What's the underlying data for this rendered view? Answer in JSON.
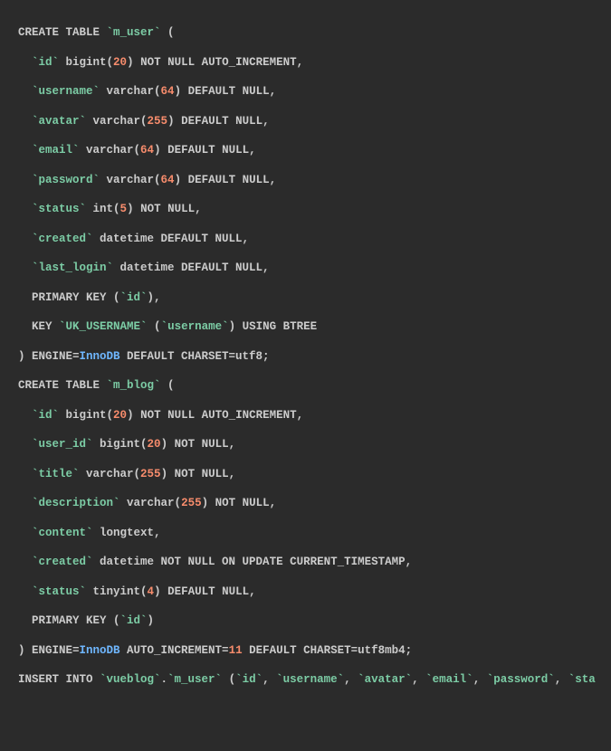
{
  "tokens": [
    [
      {
        "t": "CREATE TABLE ",
        "c": "plain"
      },
      {
        "t": "`m_user`",
        "c": "bt"
      },
      {
        "t": " (",
        "c": "plain"
      }
    ],
    [
      {
        "t": "  ",
        "c": "plain"
      },
      {
        "t": "`id`",
        "c": "bt"
      },
      {
        "t": " bigint(",
        "c": "plain"
      },
      {
        "t": "20",
        "c": "kw-num"
      },
      {
        "t": ") NOT NULL AUTO_INCREMENT,",
        "c": "plain"
      }
    ],
    [
      {
        "t": "  ",
        "c": "plain"
      },
      {
        "t": "`username`",
        "c": "bt"
      },
      {
        "t": " varchar(",
        "c": "plain"
      },
      {
        "t": "64",
        "c": "kw-num"
      },
      {
        "t": ") DEFAULT NULL,",
        "c": "plain"
      }
    ],
    [
      {
        "t": "  ",
        "c": "plain"
      },
      {
        "t": "`avatar`",
        "c": "bt"
      },
      {
        "t": " varchar(",
        "c": "plain"
      },
      {
        "t": "255",
        "c": "kw-num"
      },
      {
        "t": ") DEFAULT NULL,",
        "c": "plain"
      }
    ],
    [
      {
        "t": "  ",
        "c": "plain"
      },
      {
        "t": "`email`",
        "c": "bt"
      },
      {
        "t": " varchar(",
        "c": "plain"
      },
      {
        "t": "64",
        "c": "kw-num"
      },
      {
        "t": ") DEFAULT NULL,",
        "c": "plain"
      }
    ],
    [
      {
        "t": "  ",
        "c": "plain"
      },
      {
        "t": "`password`",
        "c": "bt"
      },
      {
        "t": " varchar(",
        "c": "plain"
      },
      {
        "t": "64",
        "c": "kw-num"
      },
      {
        "t": ") DEFAULT NULL,",
        "c": "plain"
      }
    ],
    [
      {
        "t": "  ",
        "c": "plain"
      },
      {
        "t": "`status`",
        "c": "bt"
      },
      {
        "t": " int(",
        "c": "plain"
      },
      {
        "t": "5",
        "c": "kw-num"
      },
      {
        "t": ") NOT NULL,",
        "c": "plain"
      }
    ],
    [
      {
        "t": "  ",
        "c": "plain"
      },
      {
        "t": "`created`",
        "c": "bt"
      },
      {
        "t": " datetime DEFAULT NULL,",
        "c": "plain"
      }
    ],
    [
      {
        "t": "  ",
        "c": "plain"
      },
      {
        "t": "`last_login`",
        "c": "bt"
      },
      {
        "t": " datetime DEFAULT NULL,",
        "c": "plain"
      }
    ],
    [
      {
        "t": "  PRIMARY KEY (",
        "c": "plain"
      },
      {
        "t": "`id`",
        "c": "bt"
      },
      {
        "t": "),",
        "c": "plain"
      }
    ],
    [
      {
        "t": "  KEY ",
        "c": "plain"
      },
      {
        "t": "`UK_USERNAME`",
        "c": "bt"
      },
      {
        "t": " (",
        "c": "plain"
      },
      {
        "t": "`username`",
        "c": "bt"
      },
      {
        "t": ") USING BTREE",
        "c": "plain"
      }
    ],
    [
      {
        "t": ") ENGINE=",
        "c": "plain"
      },
      {
        "t": "InnoDB",
        "c": "kw-blue"
      },
      {
        "t": " DEFAULT CHARSET=utf8;",
        "c": "plain"
      }
    ],
    [
      {
        "t": "CREATE TABLE ",
        "c": "plain"
      },
      {
        "t": "`m_blog`",
        "c": "bt"
      },
      {
        "t": " (",
        "c": "plain"
      }
    ],
    [
      {
        "t": "  ",
        "c": "plain"
      },
      {
        "t": "`id`",
        "c": "bt"
      },
      {
        "t": " bigint(",
        "c": "plain"
      },
      {
        "t": "20",
        "c": "kw-num"
      },
      {
        "t": ") NOT NULL AUTO_INCREMENT,",
        "c": "plain"
      }
    ],
    [
      {
        "t": "  ",
        "c": "plain"
      },
      {
        "t": "`user_id`",
        "c": "bt"
      },
      {
        "t": " bigint(",
        "c": "plain"
      },
      {
        "t": "20",
        "c": "kw-num"
      },
      {
        "t": ") NOT NULL,",
        "c": "plain"
      }
    ],
    [
      {
        "t": "  ",
        "c": "plain"
      },
      {
        "t": "`title`",
        "c": "bt"
      },
      {
        "t": " varchar(",
        "c": "plain"
      },
      {
        "t": "255",
        "c": "kw-num"
      },
      {
        "t": ") NOT NULL,",
        "c": "plain"
      }
    ],
    [
      {
        "t": "  ",
        "c": "plain"
      },
      {
        "t": "`description`",
        "c": "bt"
      },
      {
        "t": " varchar(",
        "c": "plain"
      },
      {
        "t": "255",
        "c": "kw-num"
      },
      {
        "t": ") NOT NULL,",
        "c": "plain"
      }
    ],
    [
      {
        "t": "  ",
        "c": "plain"
      },
      {
        "t": "`content`",
        "c": "bt"
      },
      {
        "t": " longtext,",
        "c": "plain"
      }
    ],
    [
      {
        "t": "  ",
        "c": "plain"
      },
      {
        "t": "`created`",
        "c": "bt"
      },
      {
        "t": " datetime NOT NULL ON UPDATE CURRENT_TIMESTAMP,",
        "c": "plain"
      }
    ],
    [
      {
        "t": "  ",
        "c": "plain"
      },
      {
        "t": "`status`",
        "c": "bt"
      },
      {
        "t": " tinyint(",
        "c": "plain"
      },
      {
        "t": "4",
        "c": "kw-num"
      },
      {
        "t": ") DEFAULT NULL,",
        "c": "plain"
      }
    ],
    [
      {
        "t": "  PRIMARY KEY (",
        "c": "plain"
      },
      {
        "t": "`id`",
        "c": "bt"
      },
      {
        "t": ")",
        "c": "plain"
      }
    ],
    [
      {
        "t": ") ENGINE=",
        "c": "plain"
      },
      {
        "t": "InnoDB",
        "c": "kw-blue"
      },
      {
        "t": " AUTO_INCREMENT=",
        "c": "plain"
      },
      {
        "t": "11",
        "c": "kw-num"
      },
      {
        "t": " DEFAULT CHARSET=utf8mb4;",
        "c": "plain"
      }
    ],
    [
      {
        "t": "INSERT INTO ",
        "c": "plain"
      },
      {
        "t": "`vueblog`",
        "c": "bt"
      },
      {
        "t": ".",
        "c": "plain"
      },
      {
        "t": "`m_user`",
        "c": "bt"
      },
      {
        "t": " (",
        "c": "plain"
      },
      {
        "t": "`id`",
        "c": "bt"
      },
      {
        "t": ", ",
        "c": "plain"
      },
      {
        "t": "`username`",
        "c": "bt"
      },
      {
        "t": ", ",
        "c": "plain"
      },
      {
        "t": "`avatar`",
        "c": "bt"
      },
      {
        "t": ", ",
        "c": "plain"
      },
      {
        "t": "`email`",
        "c": "bt"
      },
      {
        "t": ", ",
        "c": "plain"
      },
      {
        "t": "`password`",
        "c": "bt"
      },
      {
        "t": ", ",
        "c": "plain"
      },
      {
        "t": "`sta",
        "c": "bt"
      }
    ]
  ]
}
